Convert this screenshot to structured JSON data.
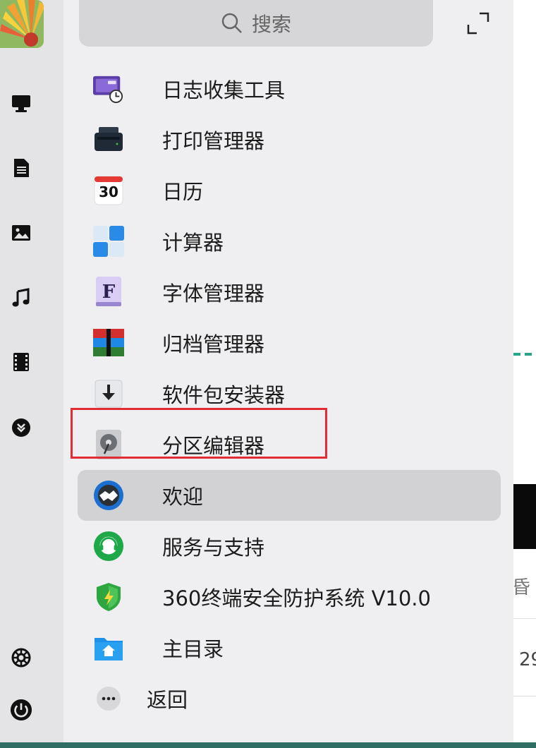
{
  "search": {
    "placeholder": "搜索"
  },
  "apps": [
    {
      "id": "log-collector",
      "label": "日志收集工具",
      "icon": "log-collector-icon"
    },
    {
      "id": "print-manager",
      "label": "打印管理器",
      "icon": "printer-icon"
    },
    {
      "id": "calendar",
      "label": "日历",
      "icon": "calendar-icon",
      "icon_text": "30"
    },
    {
      "id": "calculator",
      "label": "计算器",
      "icon": "calculator-icon"
    },
    {
      "id": "font-manager",
      "label": "字体管理器",
      "icon": "font-icon",
      "icon_text": "F"
    },
    {
      "id": "archive-manager",
      "label": "归档管理器",
      "icon": "archive-icon"
    },
    {
      "id": "package-installer",
      "label": "软件包安装器",
      "icon": "package-installer-icon"
    },
    {
      "id": "partition-editor",
      "label": "分区编辑器",
      "icon": "disk-icon",
      "highlighted": true
    },
    {
      "id": "welcome",
      "label": "欢迎",
      "icon": "handshake-icon",
      "selected": true
    },
    {
      "id": "service-support",
      "label": "服务与支持",
      "icon": "headset-icon"
    },
    {
      "id": "360-security",
      "label": "360终端安全防护系统 V10.0",
      "icon": "shield-icon"
    },
    {
      "id": "home-dir",
      "label": "主目录",
      "icon": "home-folder-icon"
    }
  ],
  "back": {
    "label": "返回",
    "icon": "more-dots-icon"
  },
  "dock": {
    "items": [
      {
        "id": "computer",
        "icon": "monitor-icon"
      },
      {
        "id": "documents",
        "icon": "document-icon"
      },
      {
        "id": "pictures",
        "icon": "image-icon"
      },
      {
        "id": "music",
        "icon": "music-note-icon"
      },
      {
        "id": "videos",
        "icon": "film-icon"
      },
      {
        "id": "downloads",
        "icon": "download-icon"
      },
      {
        "id": "settings",
        "icon": "gear-icon"
      },
      {
        "id": "power",
        "icon": "power-icon"
      }
    ]
  },
  "background_fragments": {
    "char": "昏",
    "num": "29"
  },
  "colors": {
    "highlight_border": "#e02c32",
    "selected_bg": "#d2d2d4",
    "accent_teal": "#2aa38a"
  }
}
